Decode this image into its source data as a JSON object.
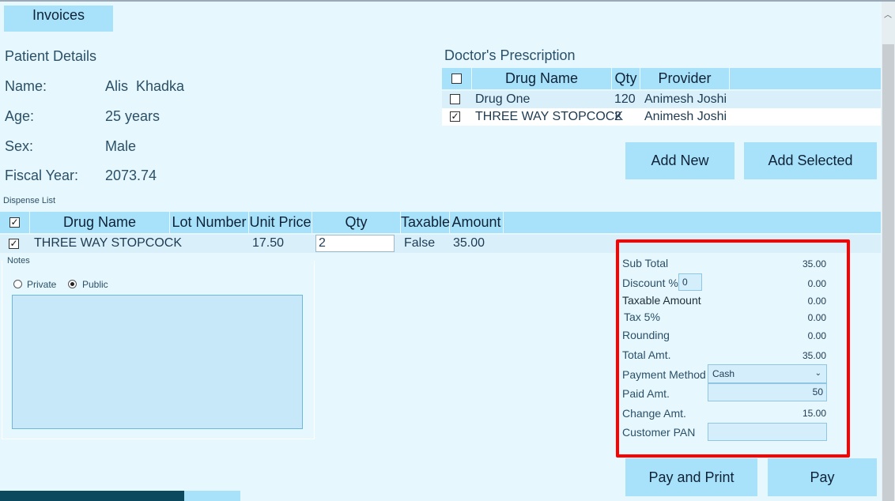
{
  "tabs": {
    "invoices": "Invoices"
  },
  "patient": {
    "title": "Patient Details",
    "fields": [
      {
        "label": "Name:",
        "value": "Alis  Khadka"
      },
      {
        "label": "Age:",
        "value": "25 years"
      },
      {
        "label": "Sex:",
        "value": "Male"
      },
      {
        "label": "Fiscal Year:",
        "value": "2073.74"
      }
    ]
  },
  "prescription": {
    "title": "Doctor's Prescription",
    "headers": [
      "Drug Name",
      "Qty",
      "Provider"
    ],
    "rows": [
      {
        "checked": false,
        "drug": "Drug One",
        "qty": "120",
        "provider": "Animesh Joshi"
      },
      {
        "checked": true,
        "drug": "THREE WAY STOPCOCK",
        "qty": "2",
        "provider": "Animesh Joshi"
      }
    ],
    "add_new": "Add New",
    "add_selected": "Add Selected"
  },
  "dispense": {
    "title": "Dispense List",
    "headers": [
      "Drug Name",
      "Lot Number",
      "Unit Price",
      "Qty",
      "Taxable",
      "Amount"
    ],
    "rows": [
      {
        "checked": true,
        "drug": "THREE WAY STOPCOCK",
        "lot": "",
        "unit_price": "17.50",
        "qty": "2",
        "taxable": "False",
        "amount": "35.00"
      }
    ]
  },
  "notes": {
    "title": "Notes",
    "private": "Private",
    "public": "Public",
    "selected": "Public"
  },
  "summary": {
    "sub_total_label": "Sub Total",
    "sub_total": "35.00",
    "discount_label": "Discount %",
    "discount_input": "0",
    "discount": "0.00",
    "taxable_label": "Taxable Amount",
    "taxable": "0.00",
    "tax_label": "Tax 5%",
    "tax": "0.00",
    "rounding_label": "Rounding",
    "rounding": "0.00",
    "total_label": "Total Amt.",
    "total": "35.00",
    "payment_method_label": "Payment Method",
    "payment_method": "Cash",
    "paid_label": "Paid Amt.",
    "paid": "50",
    "change_label": "Change Amt.",
    "change": "15.00",
    "pan_label": "Customer PAN",
    "pan": ""
  },
  "actions": {
    "pay_print": "Pay and Print",
    "pay": "Pay"
  },
  "colors": {
    "background": "#e6f7fd",
    "accent": "#a8e2fa",
    "highlight": "#ff0000",
    "taskbar": "#0b4a5e"
  }
}
